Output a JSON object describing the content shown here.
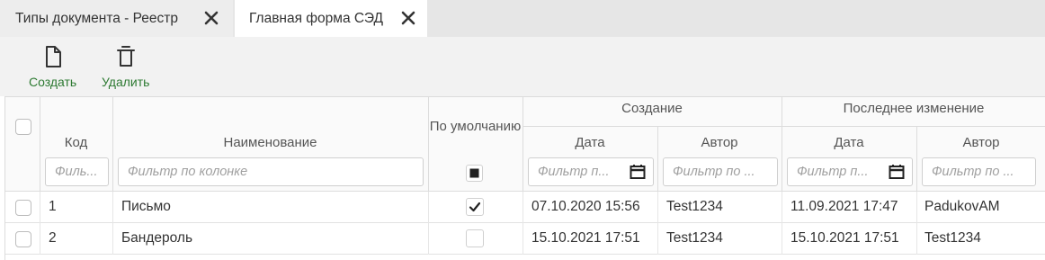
{
  "tabs": [
    {
      "label": "Типы документа - Реестр"
    },
    {
      "label": "Главная форма СЭД"
    }
  ],
  "toolbar": {
    "create_label": "Создать",
    "delete_label": "Удалить"
  },
  "grid": {
    "headers": {
      "code": "Код",
      "name": "Наименование",
      "default": "По умолчанию",
      "created_group": "Создание",
      "modified_group": "Последнее изменение",
      "date": "Дата",
      "author": "Автор"
    },
    "filters": {
      "code": "Филь...",
      "name": "Фильтр по колонке",
      "created_date": "Фильтр п...",
      "created_author": "Фильтр по ...",
      "modified_date": "Фильтр п...",
      "modified_author": "Фильтр по ..."
    },
    "rows": [
      {
        "code": "1",
        "name": "Письмо",
        "default": true,
        "created_date": "07.10.2020 15:56",
        "created_author": "Test1234",
        "modified_date": "11.09.2021 17:47",
        "modified_author": "PadukovAM"
      },
      {
        "code": "2",
        "name": "Бандероль",
        "default": false,
        "created_date": "15.10.2021 17:51",
        "created_author": "Test1234",
        "modified_date": "15.10.2021 17:51",
        "modified_author": "Test1234"
      }
    ]
  }
}
